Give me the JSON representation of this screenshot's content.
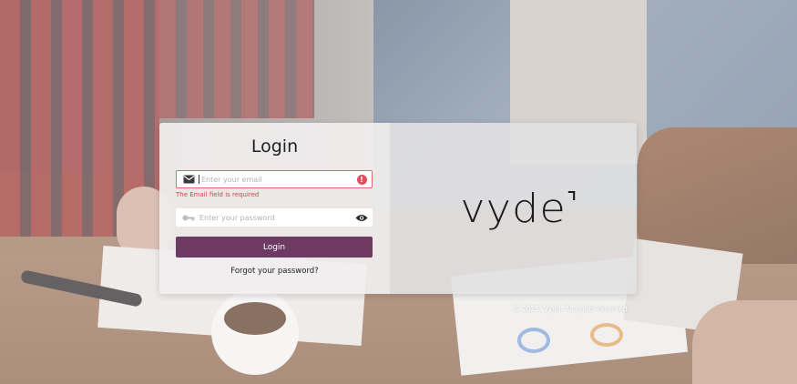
{
  "login": {
    "title": "Login",
    "email": {
      "placeholder": "Enter your email",
      "value": "",
      "leading_icon": "mail-icon",
      "trailing_icon": "error-icon",
      "error_badge": "!",
      "error": "The Email field is required"
    },
    "password": {
      "placeholder": "Enter your password",
      "value": "",
      "leading_icon": "key-icon",
      "trailing_icon": "eye-icon"
    },
    "button_label": "Login",
    "forgot_link": "Forgot your password?"
  },
  "brand": {
    "logo_text": "vyde"
  },
  "footer": {
    "copyright": "© 2025, Vyde. All rights reserved."
  },
  "colors": {
    "primary": "#6c3a63",
    "error": "#d9404d"
  }
}
